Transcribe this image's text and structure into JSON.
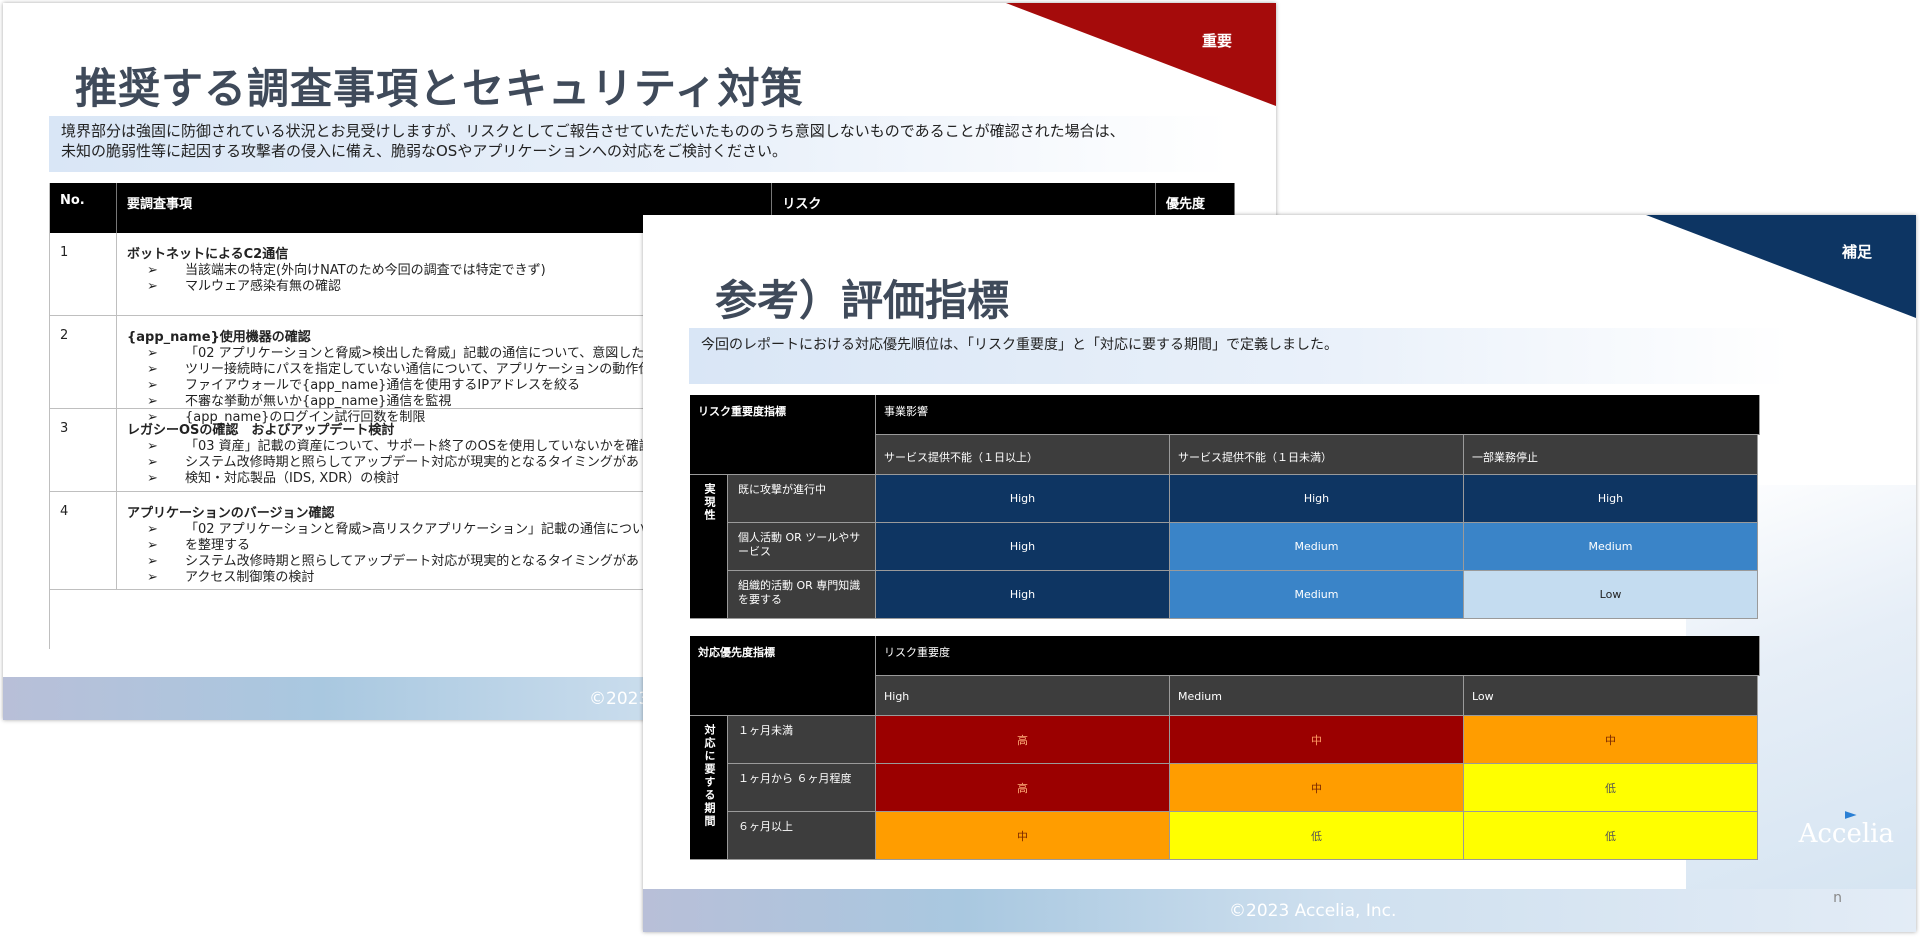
{
  "slide1": {
    "corner_tag": "重要",
    "title": "推奨する調査事項とセキュリティ対策",
    "lead_lines": [
      "境界部分は強固に防御されている状況とお見受けしますが、リスクとしてご報告させていただいたもののうち意図しないものであることが確認された場合は、",
      "未知の脆弱性等に起因する攻撃者の侵入に備え、脆弱なOSやアプリケーションへの対応をご検討ください。"
    ],
    "headers": {
      "no": "No.",
      "item": "要調査事項",
      "risk": "リスク",
      "priority": "優先度"
    },
    "rows": [
      {
        "no": "1",
        "title": "ボットネットによるC2通信",
        "bullets": [
          "当該端末の特定(外向けNATのため今回の調査では特定できず)",
          "マルウェア感染有無の確認"
        ]
      },
      {
        "no": "2",
        "title": "{app_name}使用機器の確認",
        "bullets": [
          "「02 アプリケーションと脅威>検出した脅威」記載の通信について、意図したも",
          "ツリー接続時にパスを指定していない通信について、アプリケーションの動作仕",
          "ファイアウォールで{app_name}通信を使用するIPアドレスを絞る",
          "不審な挙動が無いか{app_name}通信を監視",
          "{app_name}のログイン試行回数を制限"
        ]
      },
      {
        "no": "3",
        "title": "レガシーOSの確認　およびアップデート検討",
        "bullets": [
          "「03 資産」記載の資産について、サポート終了のOSを使用していないかを確認",
          "システム改修時期と照らしてアップデート対応が現実的となるタイミングがあ",
          "検知・対応製品（IDS, XDR）の検討"
        ]
      },
      {
        "no": "4",
        "title": "アプリケーションのバージョン確認",
        "bullets": [
          "「02 アプリケーションと脅威>高リスクアプリケーション」記載の通信につい",
          "を整理する",
          "システム改修時期と照らしてアップデート対応が現実的となるタイミングがあ",
          "アクセス制御策の検討"
        ]
      }
    ],
    "bullet_glyph": "➢",
    "footer": "©2023"
  },
  "slide2": {
    "corner_tag": "補足",
    "title": "参考）評価指標",
    "lead": "今回のレポートにおける対応優先順位は、「リスク重要度」と「対応に要する期間」で定義しました。",
    "table1": {
      "corner": "リスク重要度指標",
      "col_group": "事業影響",
      "cols": [
        "サービス提供不能（１日以上）",
        "サービス提供不能（１日未満）",
        "一部業務停止"
      ],
      "row_group": "実現性",
      "rows": [
        {
          "label": "既に攻撃が進行中",
          "values": [
            "High",
            "High",
            "High"
          ],
          "classes": [
            "c-high",
            "c-high",
            "c-high"
          ]
        },
        {
          "label": "個人活動 OR ツールやサービス",
          "values": [
            "High",
            "Medium",
            "Medium"
          ],
          "classes": [
            "c-high",
            "c-med",
            "c-med"
          ]
        },
        {
          "label": "組織的活動 OR 専門知識を要する",
          "values": [
            "High",
            "Medium",
            "Low"
          ],
          "classes": [
            "c-high",
            "c-med",
            "c-low"
          ]
        }
      ]
    },
    "table2": {
      "corner": "対応優先度指標",
      "col_group": "リスク重要度",
      "cols": [
        "High",
        "Medium",
        "Low"
      ],
      "row_group": "対応に要する期間",
      "rows": [
        {
          "label": "１ヶ月未満",
          "values": [
            "高",
            "中",
            "中"
          ],
          "classes": [
            "c-hi2",
            "c-mid2r",
            "c-mid2"
          ]
        },
        {
          "label": "１ヶ月から ６ヶ月程度",
          "values": [
            "高",
            "中",
            "低"
          ],
          "classes": [
            "c-hi2",
            "c-mid2",
            "c-lo2"
          ]
        },
        {
          "label": "６ヶ月以上",
          "values": [
            "中",
            "低",
            "低"
          ],
          "classes": [
            "c-mid2",
            "c-lo2",
            "c-lo2"
          ]
        }
      ]
    },
    "footer": "©2023 Accelia, Inc.",
    "logo": "Accelia",
    "page_num": "n",
    "colors": {
      "high": "#0e3562",
      "medium": "#3a84c8",
      "low": "#c4dcf0",
      "red": "#9b0000",
      "orange": "#ff9d00",
      "yellow": "#ffff00"
    }
  }
}
